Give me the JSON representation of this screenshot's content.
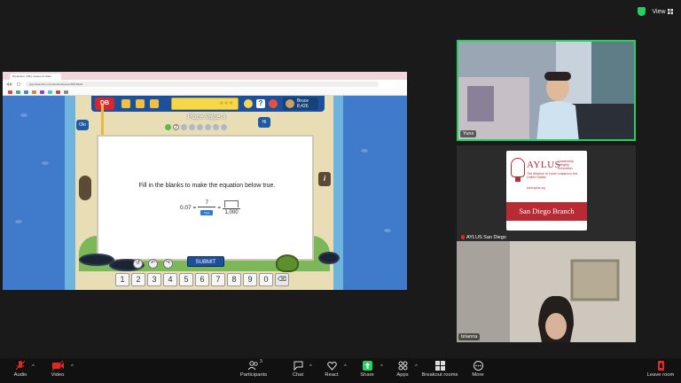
{
  "top": {
    "view_label": "View"
  },
  "browser": {
    "tab_title": "Dreambox | DB | Lesson & Class",
    "url": "play.dreambox.com/student/lesson/#/57294/2",
    "bookmark_colors": [
      "#d44",
      "#4a8",
      "#48c",
      "#c84",
      "#84c",
      "#4cc",
      "#c44",
      "#888"
    ]
  },
  "game": {
    "logo": "DB",
    "lesson_title": "Place Value 3",
    "user_name": "Bruce",
    "user_points": "8,426",
    "stars": "★★★",
    "progress_dots": [
      "",
      "2",
      "",
      "",
      "",
      "",
      "",
      ""
    ],
    "left_label": "Olo",
    "right_label": "Hi",
    "card": {
      "question": "Fill in the blanks to make the equation below true.",
      "lhs": "0.07 =",
      "frac1_num": "7",
      "frac1_den_hint": "Type",
      "equals": "=",
      "frac2_den": "1,000"
    },
    "hint_label": "i",
    "submit_label": "SUBMIT",
    "keypad": [
      "1",
      "2",
      "3",
      "4",
      "5",
      "6",
      "7",
      "8",
      "9",
      "0"
    ],
    "delete_label": "⌫"
  },
  "participants": [
    {
      "name": "Yunx"
    },
    {
      "name": "AYLUS San Diego",
      "muted": true,
      "logo": {
        "word": "AYLUS",
        "tagline": "Leadership Integrity Innovation",
        "full_name": "The Alliance of Youth Leaders in the United States",
        "website": "www.aylus.org",
        "band": "San Diego Branch"
      }
    },
    {
      "name": "brianna"
    }
  ],
  "toolbar": {
    "audio": "Audio",
    "video": "Video",
    "participants": "Participants",
    "participants_count": "3",
    "chat": "Chat",
    "react": "React",
    "share": "Share",
    "apps": "Apps",
    "breakout": "Breakout rooms",
    "more": "More",
    "leave": "Leave room"
  },
  "colors": {
    "accent_green": "#23d160",
    "muted_red": "#e02828",
    "aylus_red": "#b82b35"
  }
}
